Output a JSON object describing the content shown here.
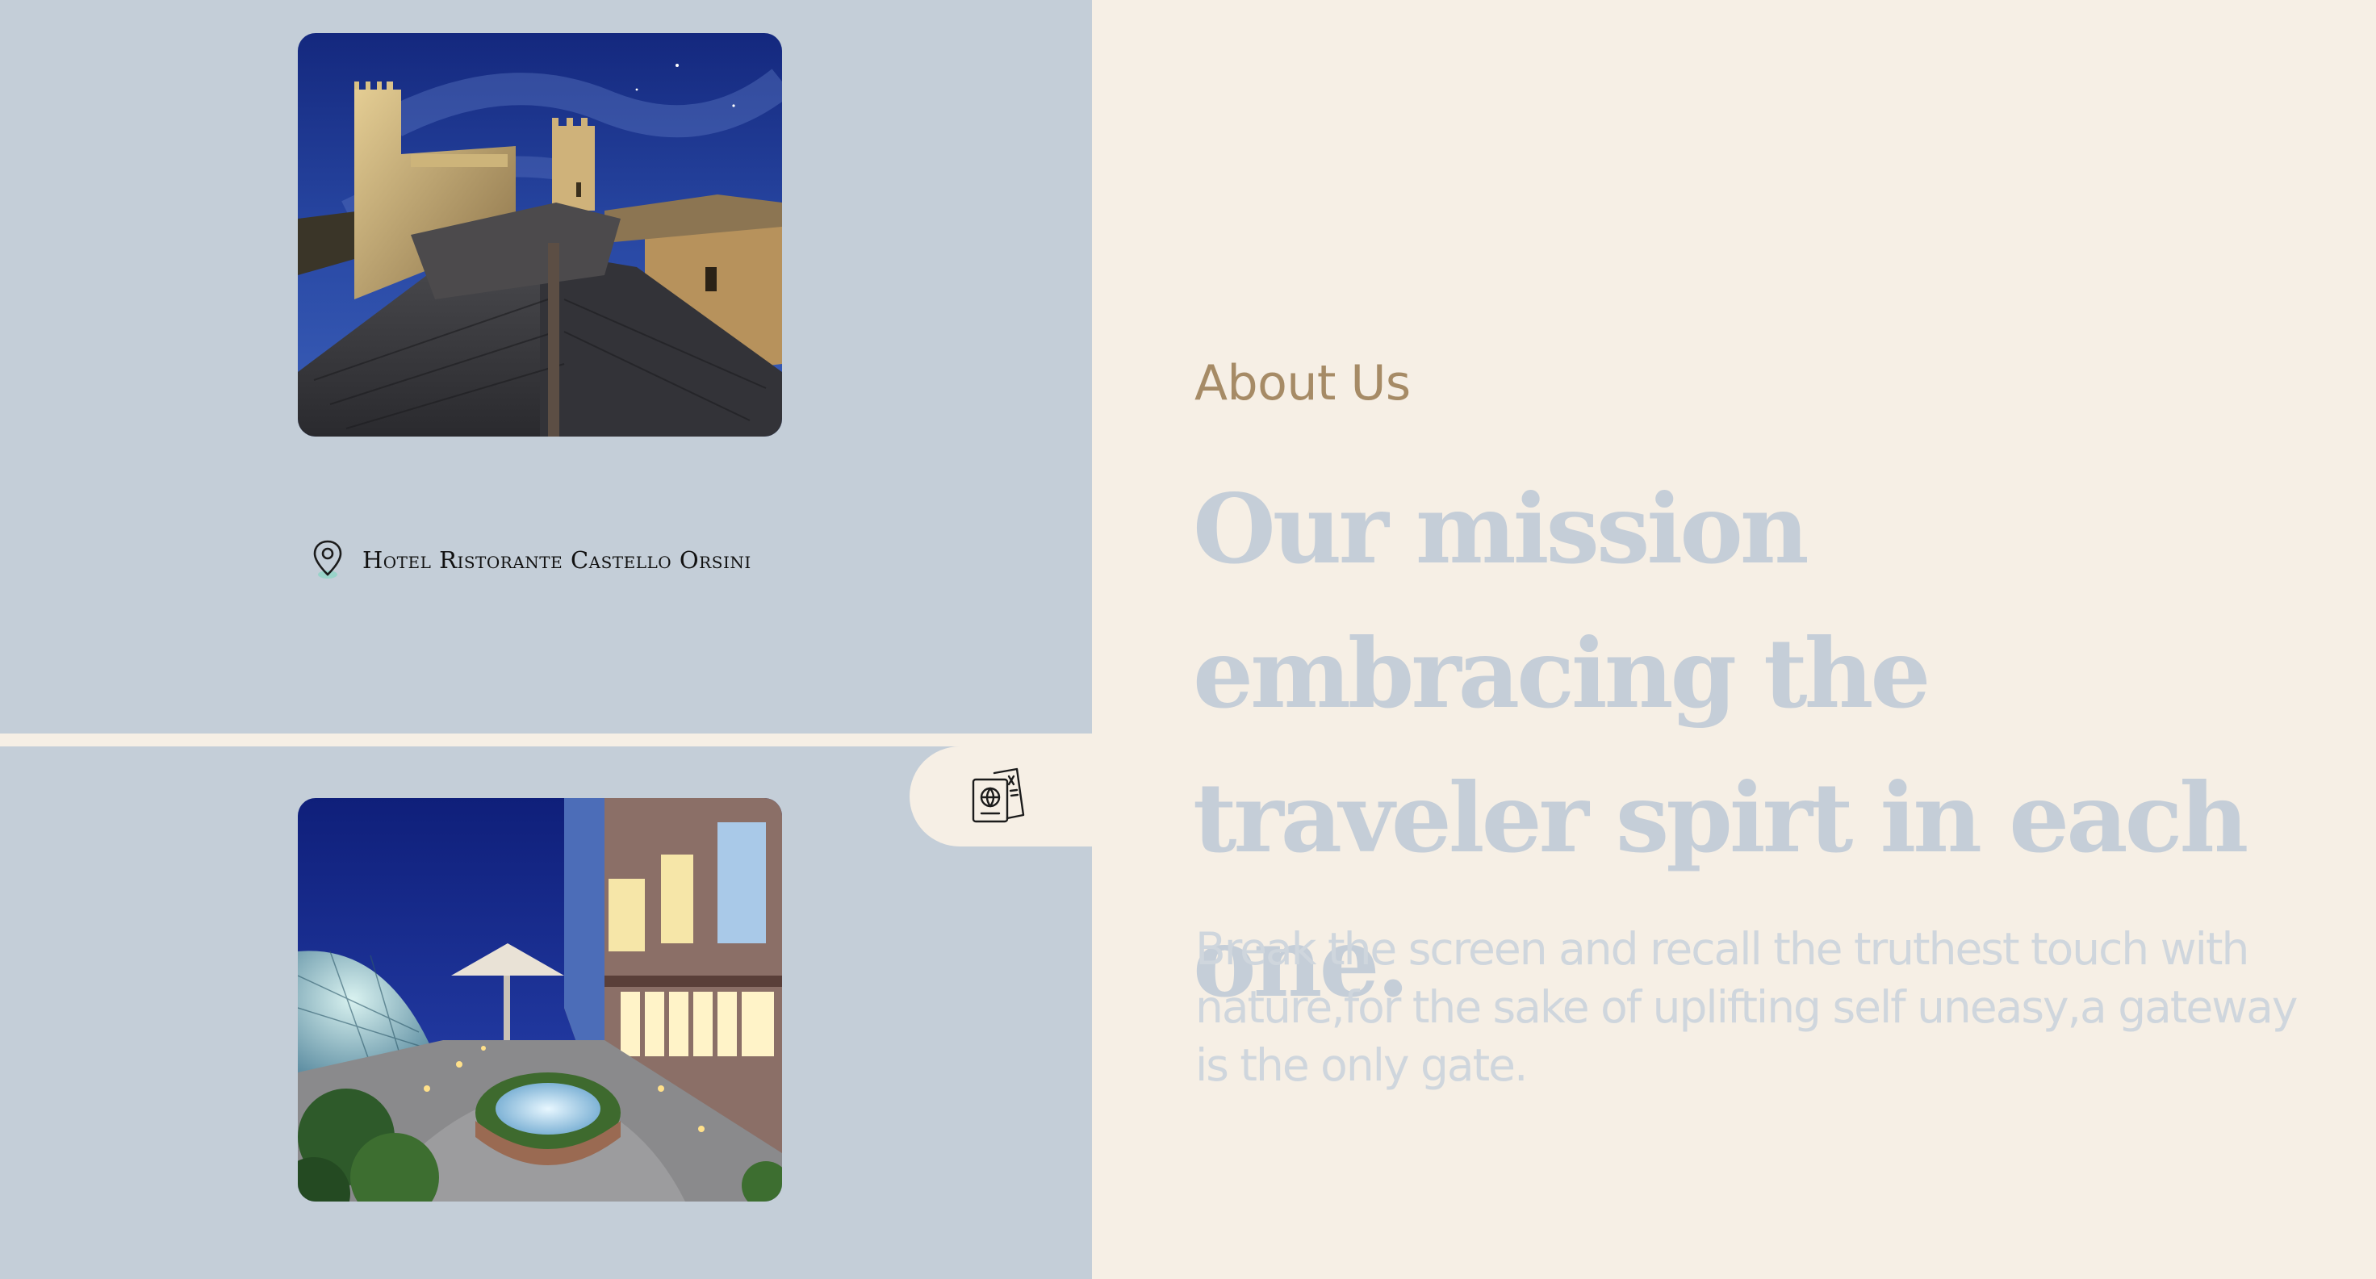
{
  "colors": {
    "page_background": "#f6efe5",
    "panel_background": "#c4ced8",
    "about_label": "#a68b66",
    "headline": "#c5ced8",
    "body_text": "#cfd6dd"
  },
  "left_panel": {
    "top_photo": {
      "icon": "castle-night-photo"
    },
    "location": {
      "icon": "map-pin-icon",
      "name": "Hotel Ristorante Castello Orsini"
    },
    "bottom_photo": {
      "icon": "hotel-courtyard-photo"
    },
    "travel_button": {
      "icon": "passport-tickets-icon"
    }
  },
  "about": {
    "label": "About Us",
    "headline": "Our mission embracing the traveler spirt in each one.",
    "body": "Break the screen and recall the truthest touch with nature,for the sake of uplifting self uneasy,a gateway is the only gate."
  }
}
